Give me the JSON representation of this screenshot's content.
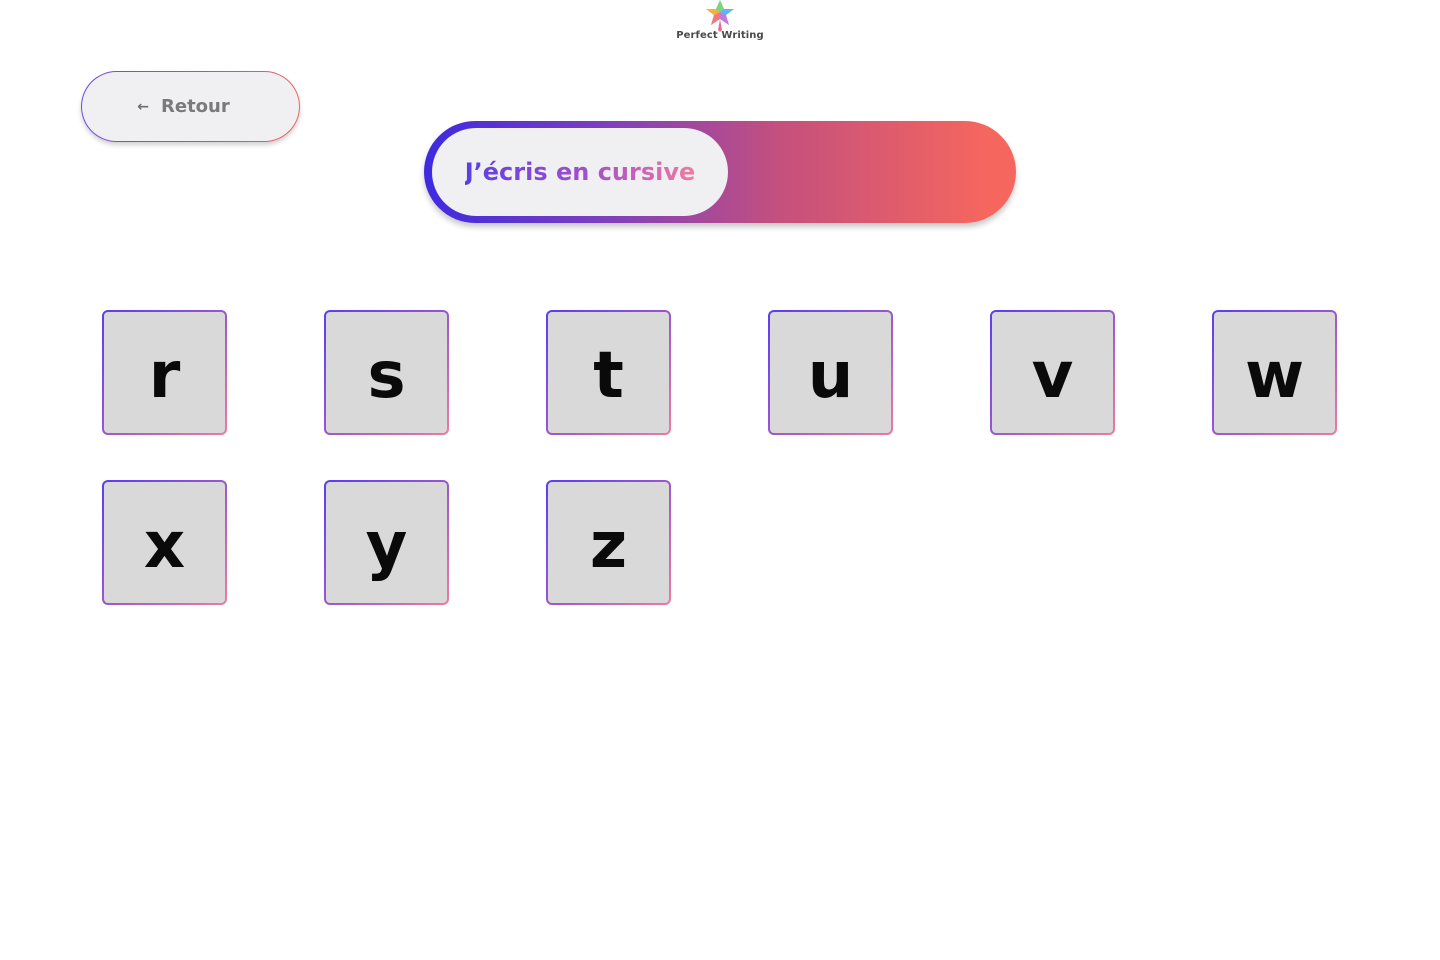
{
  "logo": {
    "text": "Perfect Writing",
    "icon": "star-logo-icon"
  },
  "back_button": {
    "label": "Retour",
    "icon": "arrow-left-icon"
  },
  "mode_toggle": {
    "label": "J’écris en cursive",
    "state": "off"
  },
  "letters": [
    "r",
    "s",
    "t",
    "u",
    "v",
    "w",
    "x",
    "y",
    "z"
  ],
  "colors": {
    "gradient_start": "#3e2ae0",
    "gradient_mid": "#c4507e",
    "gradient_end": "#f5665e",
    "card_bg": "#d9d9d9",
    "button_bg": "#f0eff1"
  }
}
